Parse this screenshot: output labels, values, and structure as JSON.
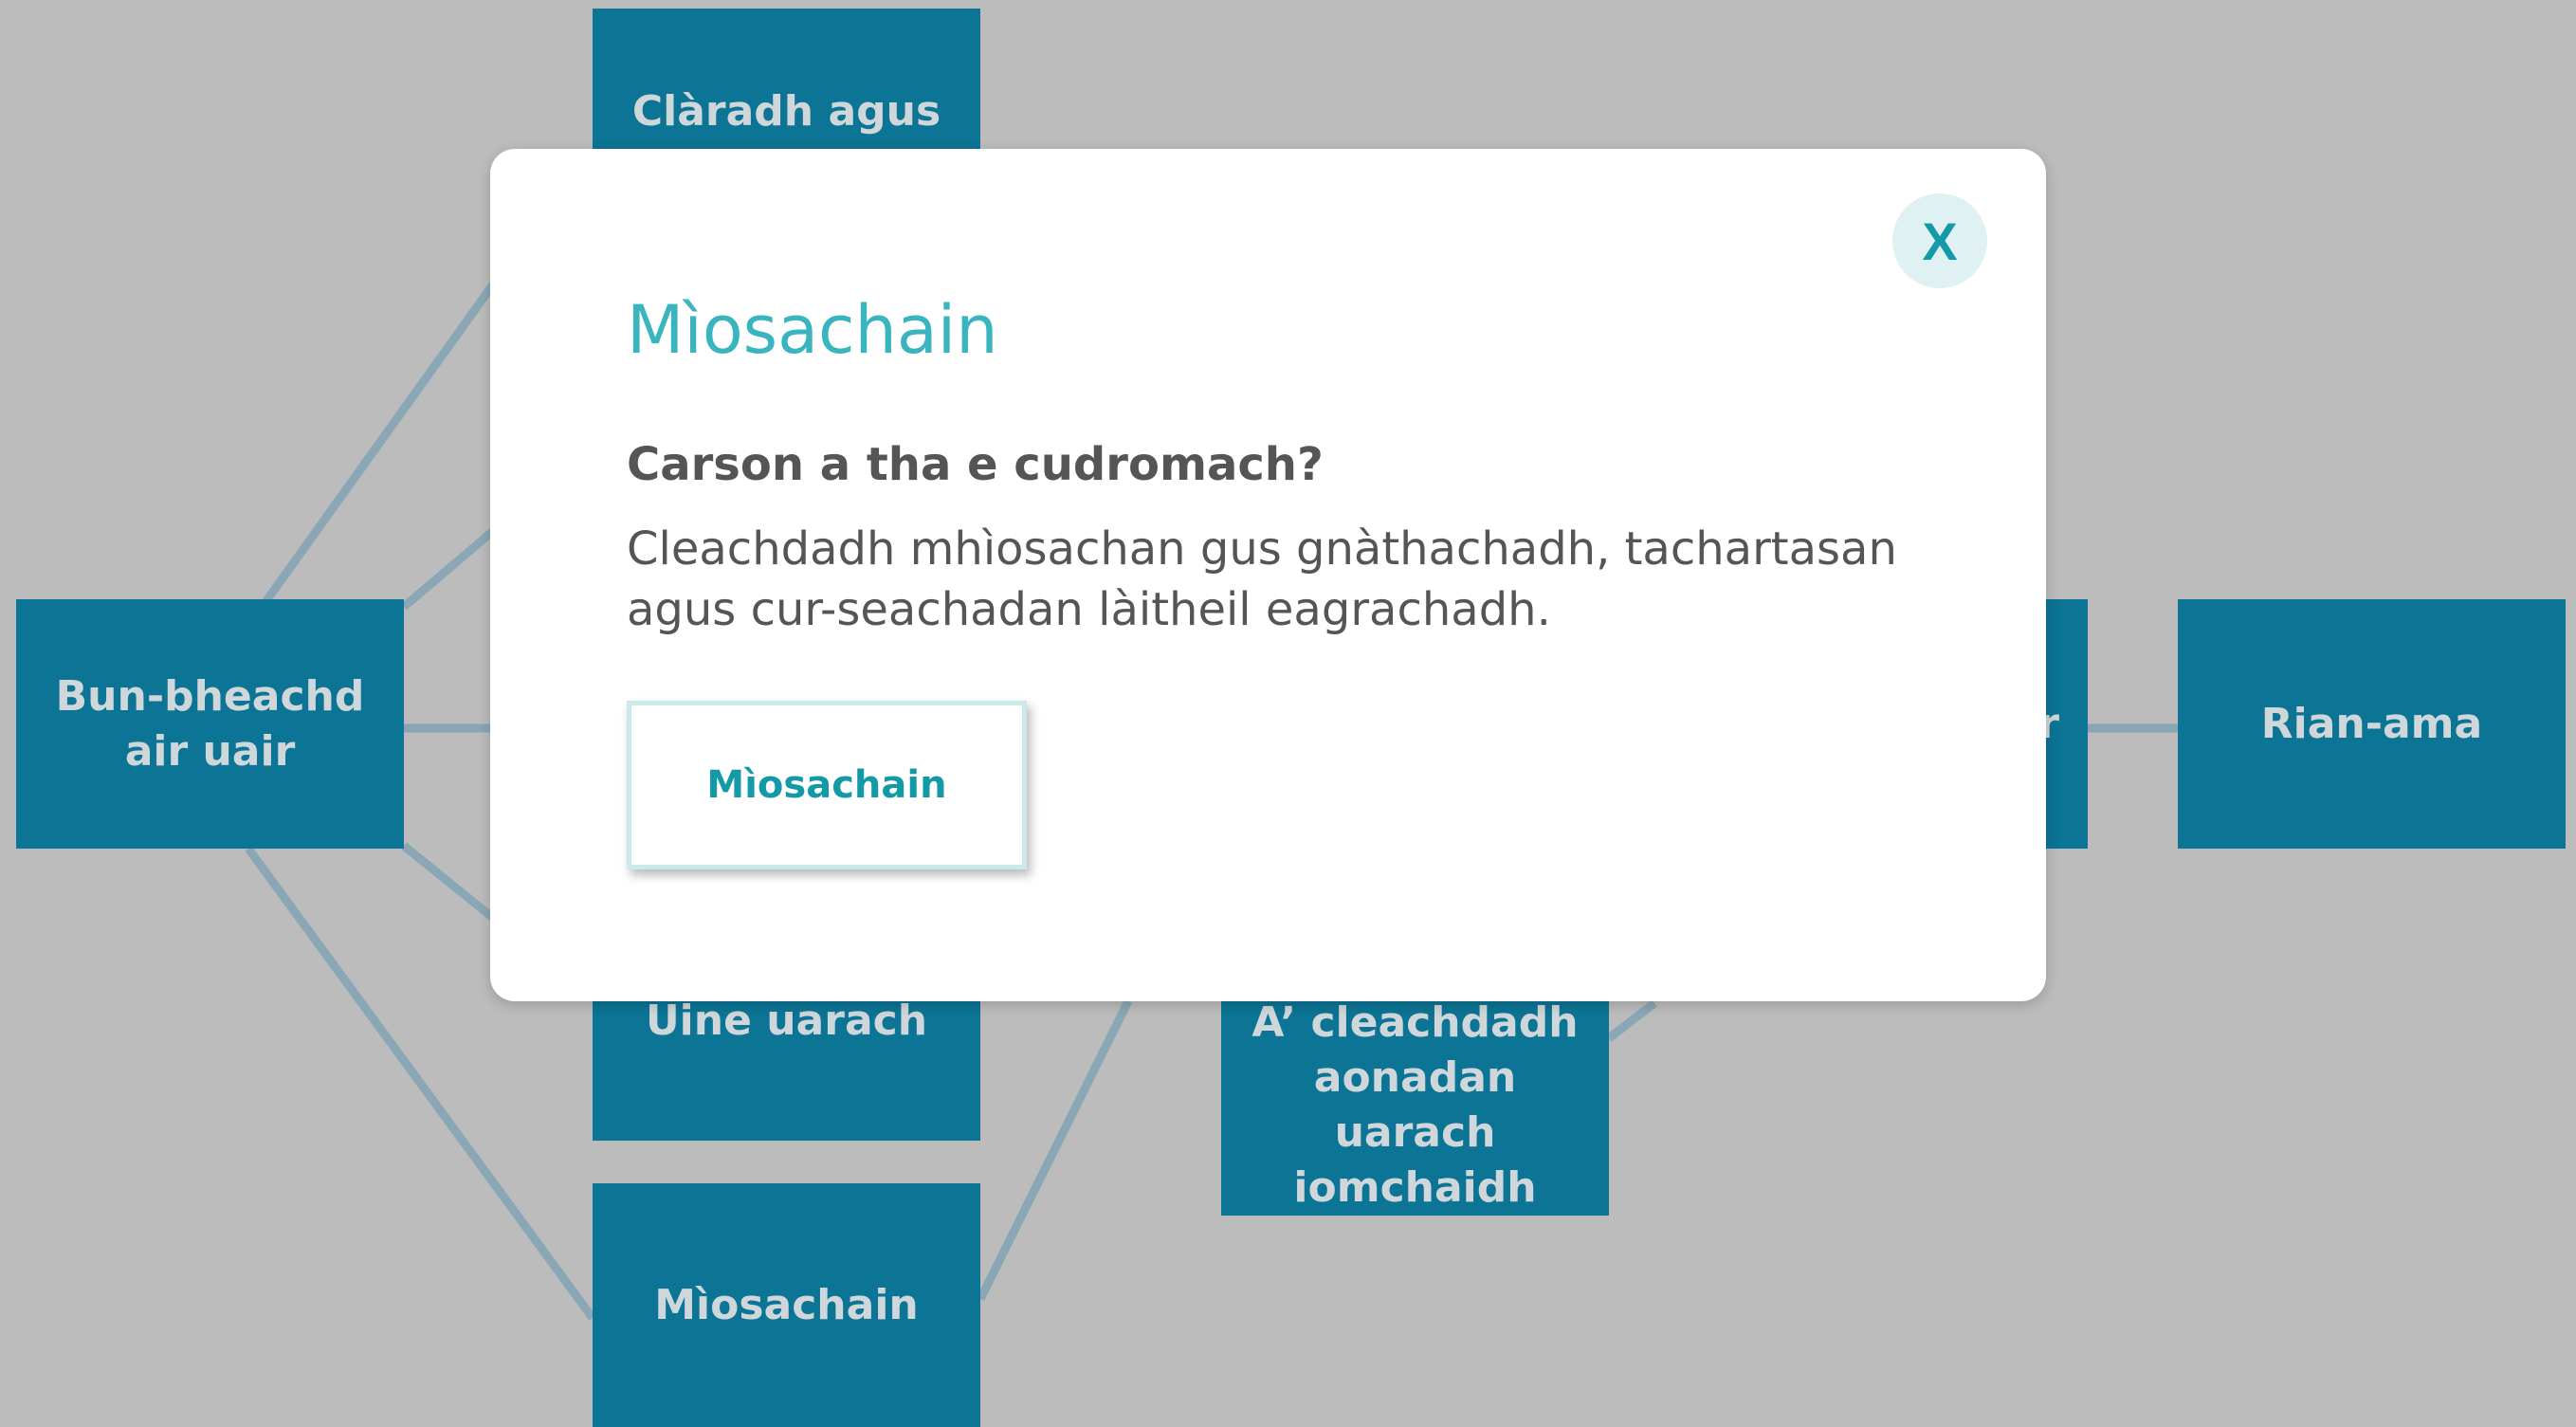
{
  "map": {
    "nodes": {
      "clar": {
        "line1": "Clàradh agus",
        "line2": ""
      },
      "bun": {
        "line1": "Bun-bheachd",
        "line2": "air uair"
      },
      "mid_right": {
        "label": "ar"
      },
      "rian": {
        "label": "Rian-ama"
      },
      "uine": {
        "label": "Ùine uarach"
      },
      "cleach": {
        "line1": "A’ cleachdadh",
        "line2": "aonadan uarach",
        "line3": "iomchaidh"
      },
      "mios": {
        "label": "Mìosachain"
      }
    },
    "colors": {
      "background": "#bcbcbc",
      "node": "#0c7494",
      "node_text": "#cfd7db",
      "link": "#8aa7b5"
    }
  },
  "modal": {
    "close_label": "X",
    "title": "Mìosachain",
    "subtitle": "Carson a tha e cudromach?",
    "body": "Cleachdadh mhìosachan gus gnàthachadh, tachartasan agus cur-seachadan làitheil eagrachadh.",
    "action_label": "Mìosachain",
    "colors": {
      "title": "#3ab4be",
      "close_bg": "#dff1f3",
      "close_fg": "#139aa6",
      "text": "#555555"
    }
  }
}
